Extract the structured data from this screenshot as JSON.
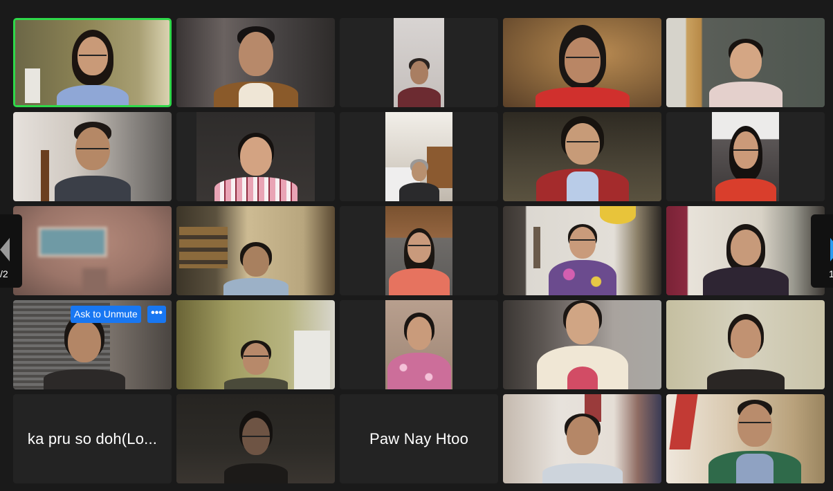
{
  "window": {
    "background": "#1a1a1a"
  },
  "colors": {
    "active_speaker": "#2fd84a",
    "action_blue": "#1877f2",
    "tile": "#232323"
  },
  "participants": [
    {
      "name": "",
      "video": true,
      "active_speaker": true
    },
    {
      "name": "",
      "video": true
    },
    {
      "name": "",
      "video": true
    },
    {
      "name": "",
      "video": true
    },
    {
      "name": "",
      "video": true
    },
    {
      "name": "",
      "video": true
    },
    {
      "name": "",
      "video": true
    },
    {
      "name": "",
      "video": true
    },
    {
      "name": "",
      "video": true
    },
    {
      "name": "",
      "video": true
    },
    {
      "name": "",
      "video": true
    },
    {
      "name": "",
      "video": true
    },
    {
      "name": "",
      "video": true
    },
    {
      "name": "",
      "video": true
    },
    {
      "name": "",
      "video": true
    },
    {
      "name": "",
      "video": true,
      "hover_controls": true
    },
    {
      "name": "",
      "video": true
    },
    {
      "name": "",
      "video": true
    },
    {
      "name": "",
      "video": true
    },
    {
      "name": "",
      "video": true
    },
    {
      "name": "ka pru so doh(Lo...",
      "video": false
    },
    {
      "name": "",
      "video": true
    },
    {
      "name": "Paw Nay Htoo",
      "video": false
    },
    {
      "name": "",
      "video": true
    },
    {
      "name": "",
      "video": true
    }
  ],
  "tile_controls": {
    "ask_to_unmute": "Ask to Unmute",
    "more": "•••",
    "more_icon": "more-options-icon"
  },
  "pagination": {
    "prev": {
      "label": "/2",
      "icon": "chevron-left-icon"
    },
    "next": {
      "label": "1",
      "icon": "chevron-right-icon"
    }
  }
}
